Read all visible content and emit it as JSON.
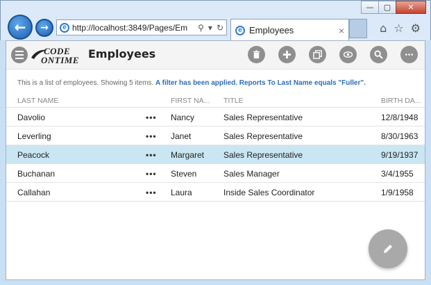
{
  "browser": {
    "url": "http://localhost:3849/Pages/Em",
    "tab_title": "Employees",
    "tab_close": "×",
    "window_buttons": [
      "—",
      "▢",
      "✕"
    ]
  },
  "toolbar": {
    "logo_line1": "CODE",
    "logo_line2": "ONTIME",
    "page_title": "Employees",
    "actions": [
      "trash-icon",
      "add-icon",
      "copy-icon",
      "view-icon",
      "search-icon",
      "more-icon"
    ]
  },
  "info": {
    "prefix": "This is a list of employees. Showing 5 items. ",
    "filter_text": "A filter has been applied. Reports To Last Name equals \"Fuller\"."
  },
  "grid": {
    "columns": {
      "last_name": "LAST NAME",
      "first_name": "FIRST NA...",
      "title": "TITLE",
      "birth_date": "BIRTH DA..."
    },
    "row_menu": "•••",
    "rows": [
      {
        "last_name": "Davolio",
        "first_name": "Nancy",
        "title": "Sales Representative",
        "birth_date": "12/8/1948"
      },
      {
        "last_name": "Leverling",
        "first_name": "Janet",
        "title": "Sales Representative",
        "birth_date": "8/30/1963"
      },
      {
        "last_name": "Peacock",
        "first_name": "Margaret",
        "title": "Sales Representative",
        "birth_date": "9/19/1937"
      },
      {
        "last_name": "Buchanan",
        "first_name": "Steven",
        "title": "Sales Manager",
        "birth_date": "3/4/1955"
      },
      {
        "last_name": "Callahan",
        "first_name": "Laura",
        "title": "Inside Sales Coordinator",
        "birth_date": "1/9/1958"
      }
    ],
    "selected_row": 2
  },
  "colors": {
    "selected_row": "#c9e6f2",
    "filter_link": "#2d6db8",
    "action_button": "#8f8f8f"
  }
}
